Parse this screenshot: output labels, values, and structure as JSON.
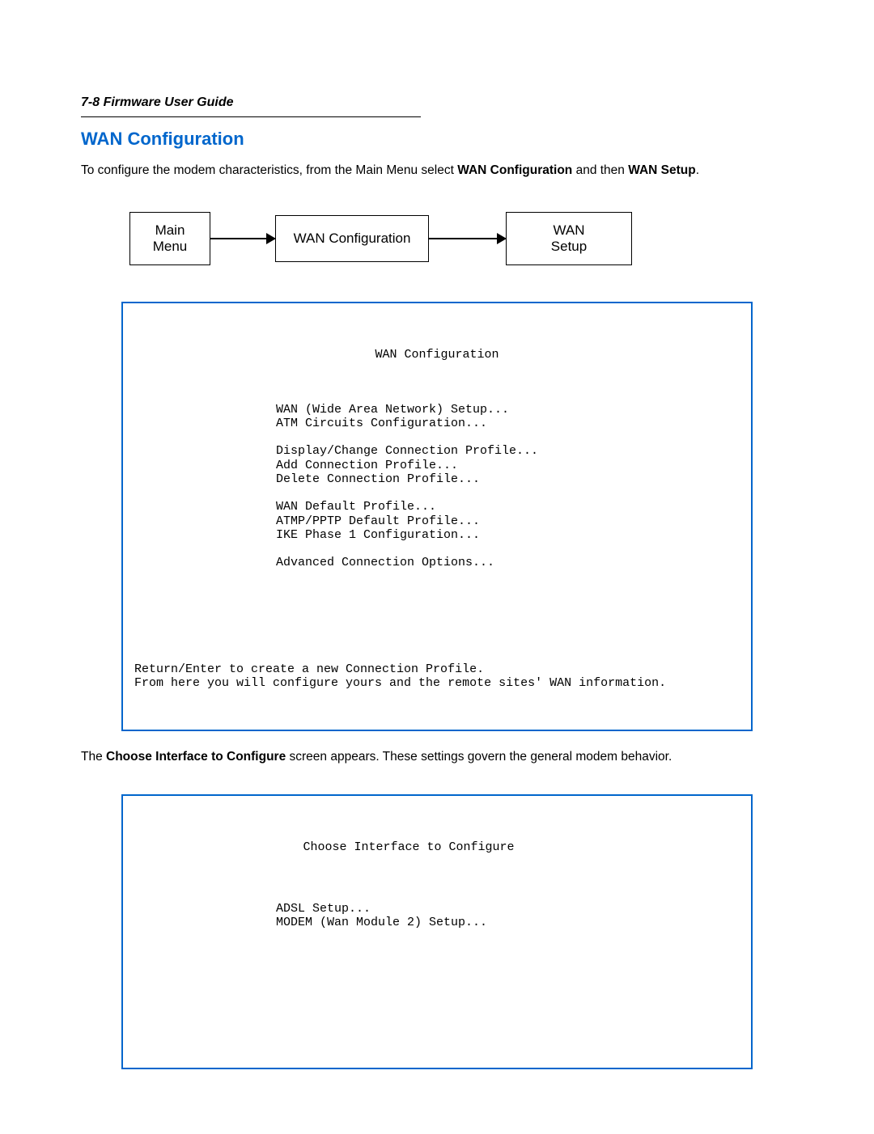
{
  "header": {
    "page_ref": "7-8  Firmware User Guide"
  },
  "heading": "WAN Configuration",
  "intro": {
    "pre": "To configure the modem characteristics, from the Main Menu select ",
    "bold1": "WAN Configuration",
    "mid": " and then ",
    "bold2": "WAN Setup",
    "end": "."
  },
  "diagram": {
    "box1_l1": "Main",
    "box1_l2": "Menu",
    "box2": "WAN Configuration",
    "box3_l1": "WAN",
    "box3_l2": "Setup"
  },
  "terminal1": {
    "title": "WAN Configuration",
    "group1_l1": "WAN (Wide Area Network) Setup...",
    "group1_l2": "ATM Circuits Configuration...",
    "group2_l1": "Display/Change Connection Profile...",
    "group2_l2": "Add Connection Profile...",
    "group2_l3": "Delete Connection Profile...",
    "group3_l1": "WAN Default Profile...",
    "group3_l2": "ATMP/PPTP Default Profile...",
    "group3_l3": "IKE Phase 1 Configuration...",
    "group4_l1": "Advanced Connection Options...",
    "footer_l1": "Return/Enter to create a new Connection Profile.",
    "footer_l2": "From here you will configure yours and the remote sites' WAN information."
  },
  "midtext": {
    "pre": "The ",
    "bold": "Choose Interface to Configure",
    "post": " screen appears. These settings govern the general modem behavior."
  },
  "terminal2": {
    "title": "Choose Interface to Configure",
    "l1": "ADSL Setup...",
    "l2": "MODEM (Wan Module 2) Setup..."
  }
}
